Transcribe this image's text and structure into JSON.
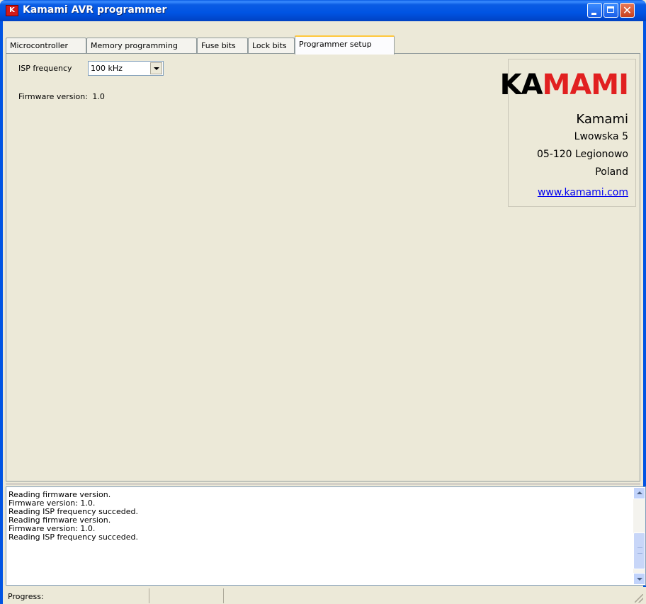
{
  "window": {
    "title": "Kamami AVR programmer",
    "icon": "kamami-app-icon",
    "icon_text": "K"
  },
  "tabs": [
    {
      "label": "Microcontroller",
      "active": false
    },
    {
      "label": "Memory programming",
      "active": false
    },
    {
      "label": "Fuse bits",
      "active": false
    },
    {
      "label": "Lock bits",
      "active": false
    },
    {
      "label": "Programmer setup",
      "active": true
    }
  ],
  "setup": {
    "isp_label": "ISP frequency",
    "isp_value": "100 kHz",
    "firmware_label": "Firmware version:",
    "firmware_value": "1.0"
  },
  "company": {
    "logo_ka": "KA",
    "logo_mami": "MAMI",
    "name": "Kamami",
    "street": "Lwowska 5",
    "city": "05-120 Legionowo",
    "country": "Poland",
    "website": "www.kamami.com"
  },
  "log": [
    "Reading firmware version.",
    "Firmware version: 1.0.",
    "Reading ISP frequency succeded.",
    "Reading firmware version.",
    "Firmware version: 1.0.",
    "Reading ISP frequency succeded."
  ],
  "status": {
    "progress_label": "Progress:"
  },
  "colors": {
    "titlebar": "#0054e3",
    "logo_red": "#e12020",
    "link": "#0000ee",
    "active_tab_accent": "#ffc83c"
  }
}
